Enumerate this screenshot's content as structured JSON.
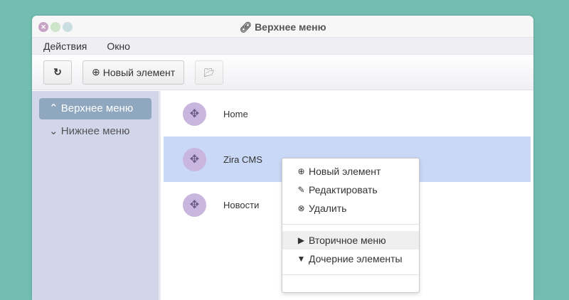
{
  "window": {
    "title": "Верхнее меню"
  },
  "menubar": [
    "Действия",
    "Окно"
  ],
  "toolbar": {
    "new_label": "Новый элемент"
  },
  "sidebar": [
    {
      "label": "Верхнее меню"
    },
    {
      "label": "Нижнее меню"
    }
  ],
  "rows": [
    {
      "label": "Home"
    },
    {
      "label": "Zira CMS"
    },
    {
      "label": "Новости"
    }
  ],
  "context_menu": [
    "Новый элемент",
    "Редактировать",
    "Удалить",
    "Вторичное меню",
    "Дочерние элементы"
  ]
}
